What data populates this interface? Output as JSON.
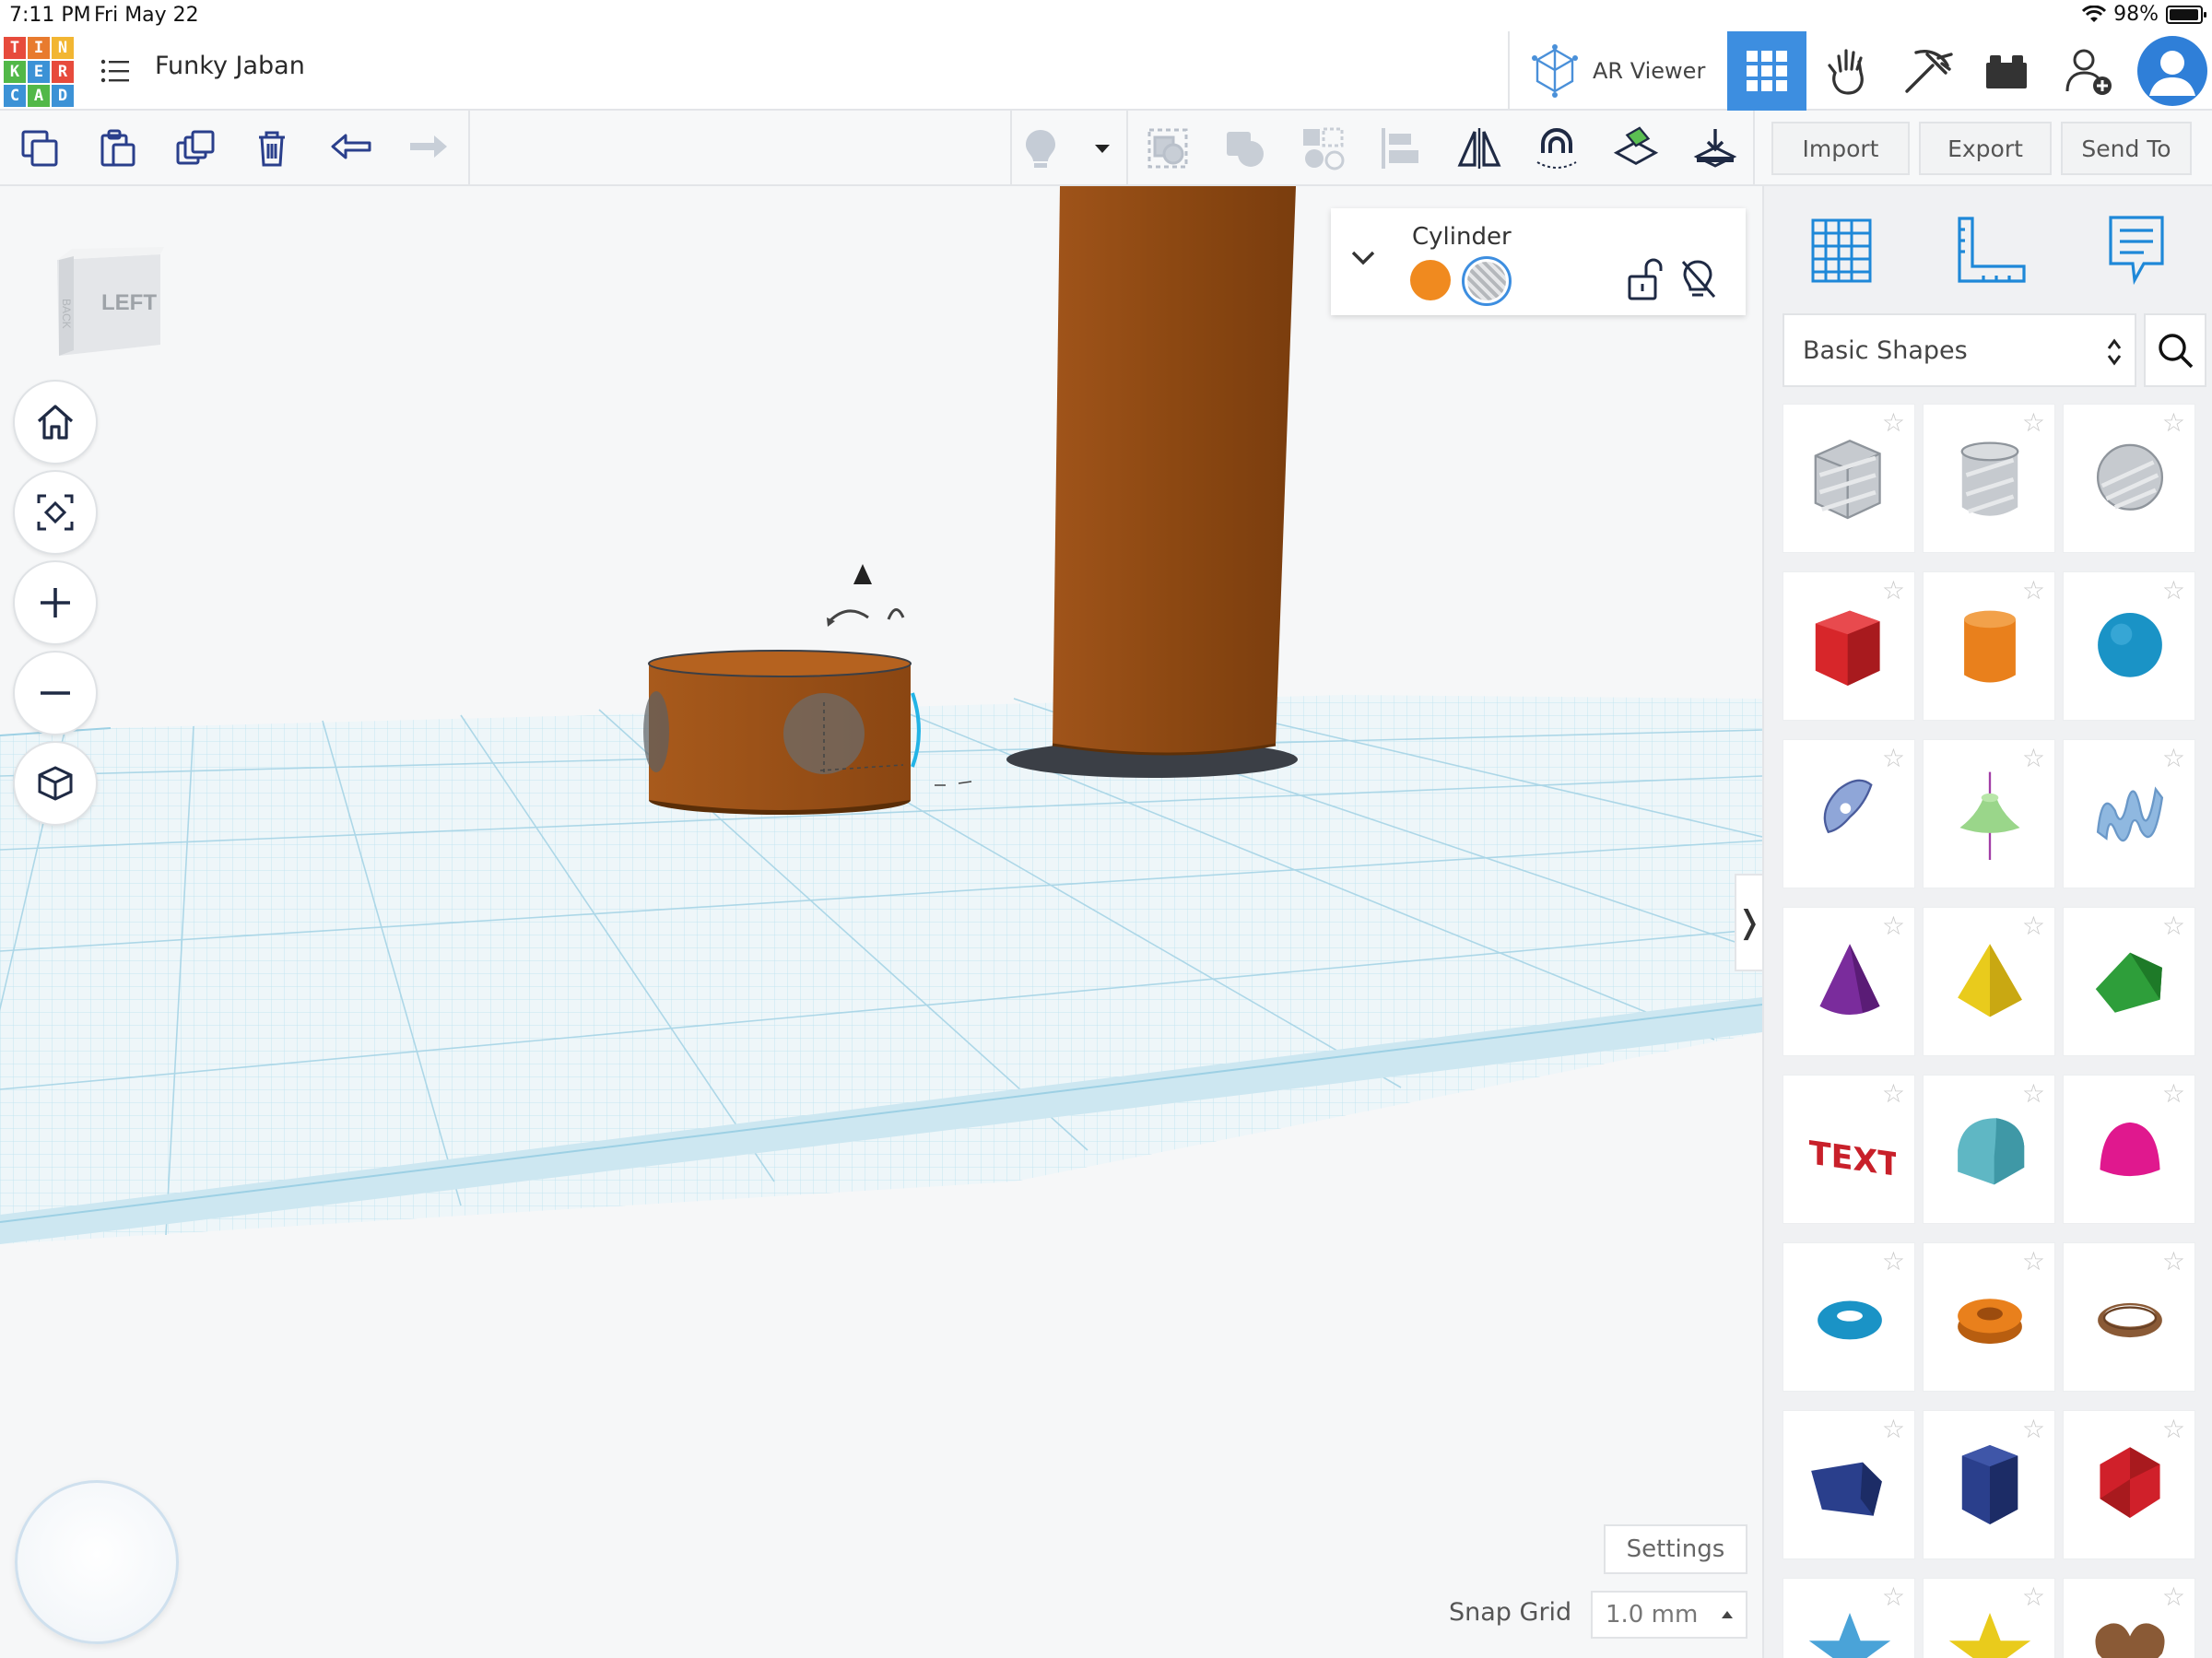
{
  "status_bar": {
    "time": "7:11 PM",
    "date": "Fri May 22",
    "battery": "98%"
  },
  "app": {
    "logo_letters": [
      "T",
      "I",
      "N",
      "K",
      "E",
      "R",
      "C",
      "A",
      "D"
    ],
    "logo_colors": [
      "#e74b3c",
      "#e87b2e",
      "#f2b632",
      "#52b848",
      "#3c92d6",
      "#e74b3c",
      "#3c92d6",
      "#52b848",
      "#3c92d6"
    ],
    "design_name": "Funky Jaban",
    "accent": "#3d8ee0"
  },
  "header": {
    "ar_viewer_label": "AR Viewer",
    "buttons": [
      "grid-view-icon",
      "tinker-hand-icon",
      "pickaxe-icon",
      "bricks-icon",
      "add-user-icon",
      "profile-avatar"
    ]
  },
  "toolbar": {
    "left_icons": [
      "copy-icon",
      "paste-icon",
      "duplicate-icon",
      "delete-icon",
      "undo-icon",
      "redo-icon"
    ],
    "right_icons": [
      "bulb-icon",
      "dropdown-icon",
      "group-icon",
      "ungroup-icon",
      "hole-icon",
      "align-icon",
      "mirror-icon",
      "magnet-icon",
      "workplane-icon",
      "drop-icon"
    ],
    "import_label": "Import",
    "export_label": "Export",
    "send_to_label": "Send To"
  },
  "view_cube": {
    "face_label": "LEFT",
    "side_label": "BACK"
  },
  "inspector": {
    "title": "Cylinder",
    "solid_color": "#f08a1f",
    "hole_option": "hole-pattern"
  },
  "canvas": {
    "settings_label": "Settings",
    "snap_grid_label": "Snap Grid",
    "snap_grid_value": "1.0 mm",
    "panel_toggle": "❭"
  },
  "right_panel": {
    "tabs": [
      "workplane-grid-icon",
      "ruler-icon",
      "notes-icon"
    ],
    "library": "Basic Shapes",
    "shapes": [
      {
        "name": "box-hole",
        "color": "#b9bec4"
      },
      {
        "name": "cylinder-hole",
        "color": "#b9bec4"
      },
      {
        "name": "sphere-hole",
        "color": "#b9bec4"
      },
      {
        "name": "box",
        "color": "#d7262a"
      },
      {
        "name": "cylinder",
        "color": "#e9801c"
      },
      {
        "name": "sphere",
        "color": "#1a93c6"
      },
      {
        "name": "scribble",
        "color": "#8fa6d8"
      },
      {
        "name": "shape-generator",
        "color": "#9ad68a"
      },
      {
        "name": "text-wave",
        "color": "#8fb8e0"
      },
      {
        "name": "cone",
        "color": "#7a2c9c"
      },
      {
        "name": "pyramid",
        "color": "#e9cb1c"
      },
      {
        "name": "roof",
        "color": "#2e9e3a"
      },
      {
        "name": "text",
        "color": "#c8202a"
      },
      {
        "name": "half-cylinder",
        "color": "#5fb7c4"
      },
      {
        "name": "paraboloid",
        "color": "#e0188e"
      },
      {
        "name": "torus",
        "color": "#1a93c6"
      },
      {
        "name": "tube",
        "color": "#e9801c"
      },
      {
        "name": "ring",
        "color": "#8a5a36"
      },
      {
        "name": "wedge-polygon",
        "color": "#2a3f8c"
      },
      {
        "name": "hexagonal-prism",
        "color": "#2a3f8c"
      },
      {
        "name": "icosahedron",
        "color": "#d0202a"
      },
      {
        "name": "star",
        "color": "#4aa3d8"
      },
      {
        "name": "star-yellow",
        "color": "#e9cb1c"
      },
      {
        "name": "heart",
        "color": "#8a5a36"
      }
    ]
  }
}
